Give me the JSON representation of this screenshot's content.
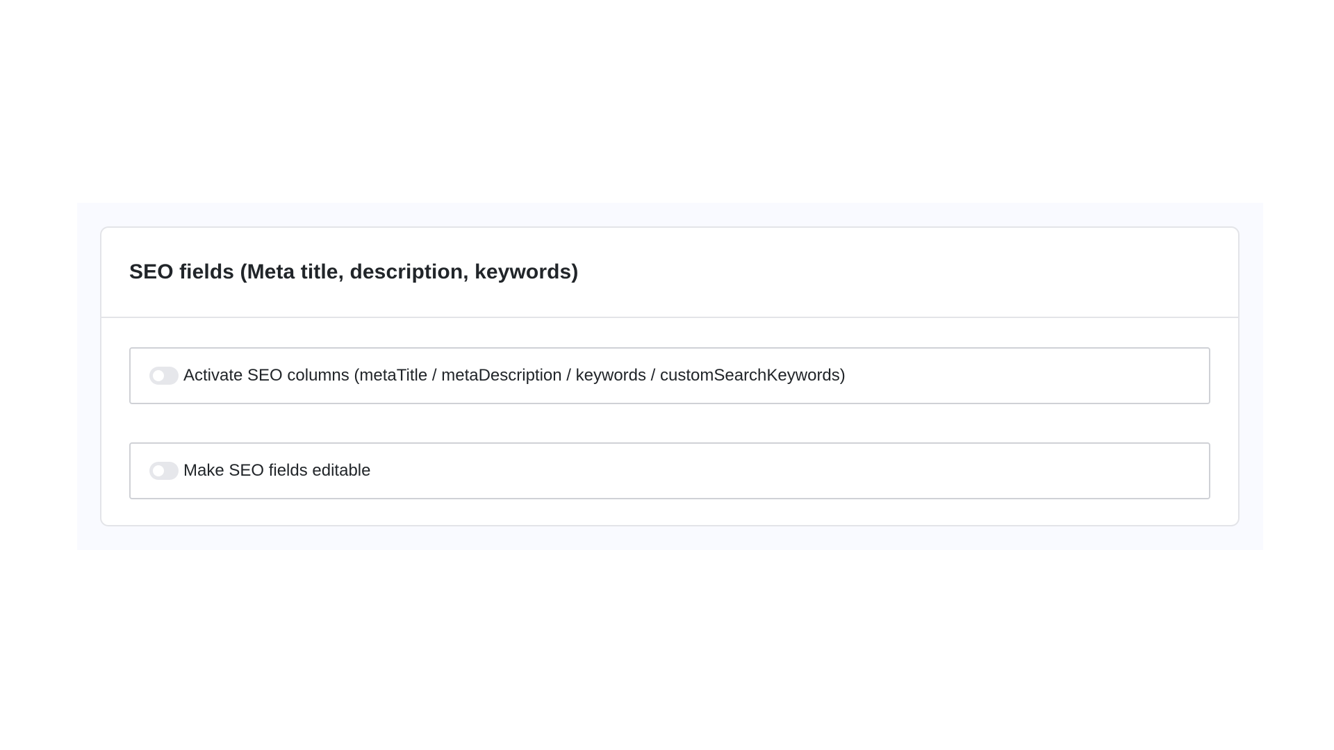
{
  "section": {
    "title": "SEO fields (Meta title, description, keywords)"
  },
  "options": [
    {
      "label": "Activate SEO columns (metaTitle / metaDescription / keywords / customSearchKeywords)",
      "enabled": false
    },
    {
      "label": "Make SEO fields editable",
      "enabled": false
    }
  ],
  "colors": {
    "outer_background": "#f9faff",
    "card_border": "#e3e4e8",
    "toggle_off": "#e6e7eb",
    "text": "#212529"
  }
}
